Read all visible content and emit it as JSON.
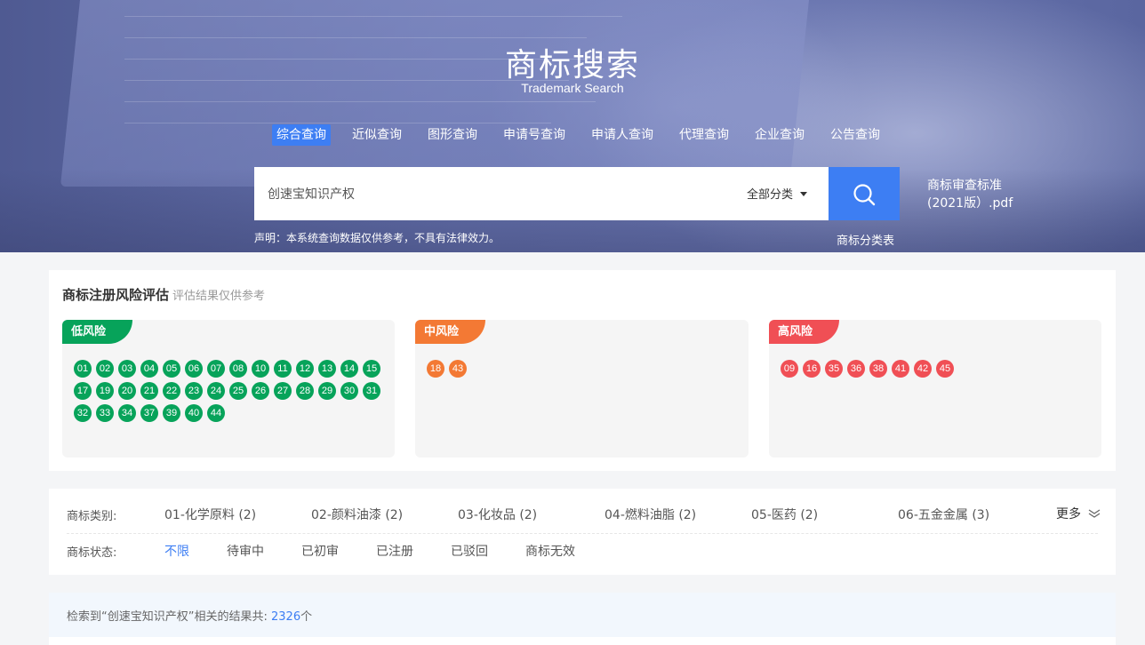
{
  "hero": {
    "title": "商标搜索",
    "subtitle": "Trademark Search",
    "tabs": [
      "综合查询",
      "近似查询",
      "图形查询",
      "申请号查询",
      "申请人查询",
      "代理查询",
      "企业查询",
      "公告查询"
    ],
    "active_tab": 0,
    "search_value": "创速宝知识产权",
    "category_select": "全部分类",
    "pdf_link_line1": "商标审查标准",
    "pdf_link_line2": "(2021版）.pdf",
    "disclaimer": "声明：本系统查询数据仅供参考，不具有法律效力。",
    "class_table_link": "商标分类表",
    "accent": "#3d7ef3"
  },
  "risk": {
    "title": "商标注册风险评估",
    "hint": "评估结果仅供参考",
    "groups": [
      {
        "label": "低风险",
        "color": "#07a35a",
        "codes": [
          "01",
          "02",
          "03",
          "04",
          "05",
          "06",
          "07",
          "08",
          "10",
          "11",
          "12",
          "13",
          "14",
          "15",
          "17",
          "19",
          "20",
          "21",
          "22",
          "23",
          "24",
          "25",
          "26",
          "27",
          "28",
          "29",
          "30",
          "31",
          "32",
          "33",
          "34",
          "37",
          "39",
          "40",
          "44"
        ]
      },
      {
        "label": "中风险",
        "color": "#f37934",
        "codes": [
          "18",
          "43"
        ]
      },
      {
        "label": "高风险",
        "color": "#f04f55",
        "codes": [
          "09",
          "16",
          "35",
          "36",
          "38",
          "41",
          "42",
          "45"
        ]
      }
    ]
  },
  "filters": {
    "category_label": "商标类别:",
    "categories": [
      "01-化学原料 (2)",
      "02-颜料油漆 (2)",
      "03-化妆品 (2)",
      "04-燃料油脂 (2)",
      "05-医药 (2)",
      "06-五金金属 (3)"
    ],
    "more_label": "更多",
    "status_label": "商标状态:",
    "statuses": [
      "不限",
      "待审中",
      "已初审",
      "已注册",
      "已驳回",
      "商标无效"
    ],
    "active_status": 0
  },
  "results": {
    "prefix": "检索到“创速宝知识产权”相关的结果共:",
    "count": "2326",
    "suffix": "个"
  }
}
